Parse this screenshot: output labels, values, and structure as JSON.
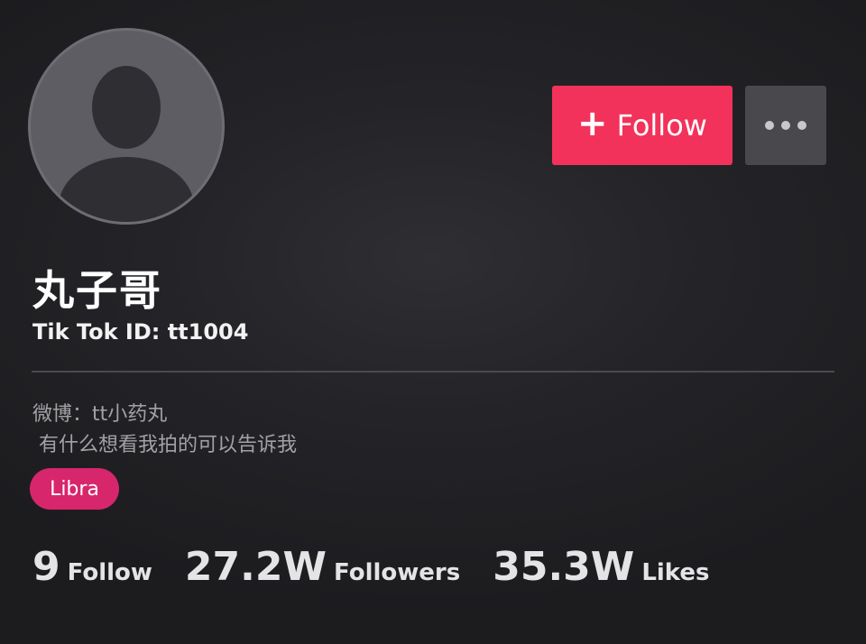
{
  "profile": {
    "display_name": "丸子哥",
    "tiktok_id": "Tik Tok ID: tt1004",
    "bio_line_1": "微博：tt小药丸",
    "bio_line_2": " 有什么想看我拍的可以告诉我",
    "zodiac_badge": "Libra"
  },
  "actions": {
    "follow_plus": "+",
    "follow_label": "Follow",
    "more_icon": "more-horizontal-icon"
  },
  "stats": [
    {
      "value": "9",
      "label": "Follow"
    },
    {
      "value": "27.2W",
      "label": "Followers"
    },
    {
      "value": "35.3W",
      "label": "Likes"
    }
  ],
  "colors": {
    "follow_button": "#f2325a",
    "more_button": "#48484d",
    "zodiac_badge": "#d8266c",
    "background": "#242428",
    "avatar": "#5d5d63"
  }
}
